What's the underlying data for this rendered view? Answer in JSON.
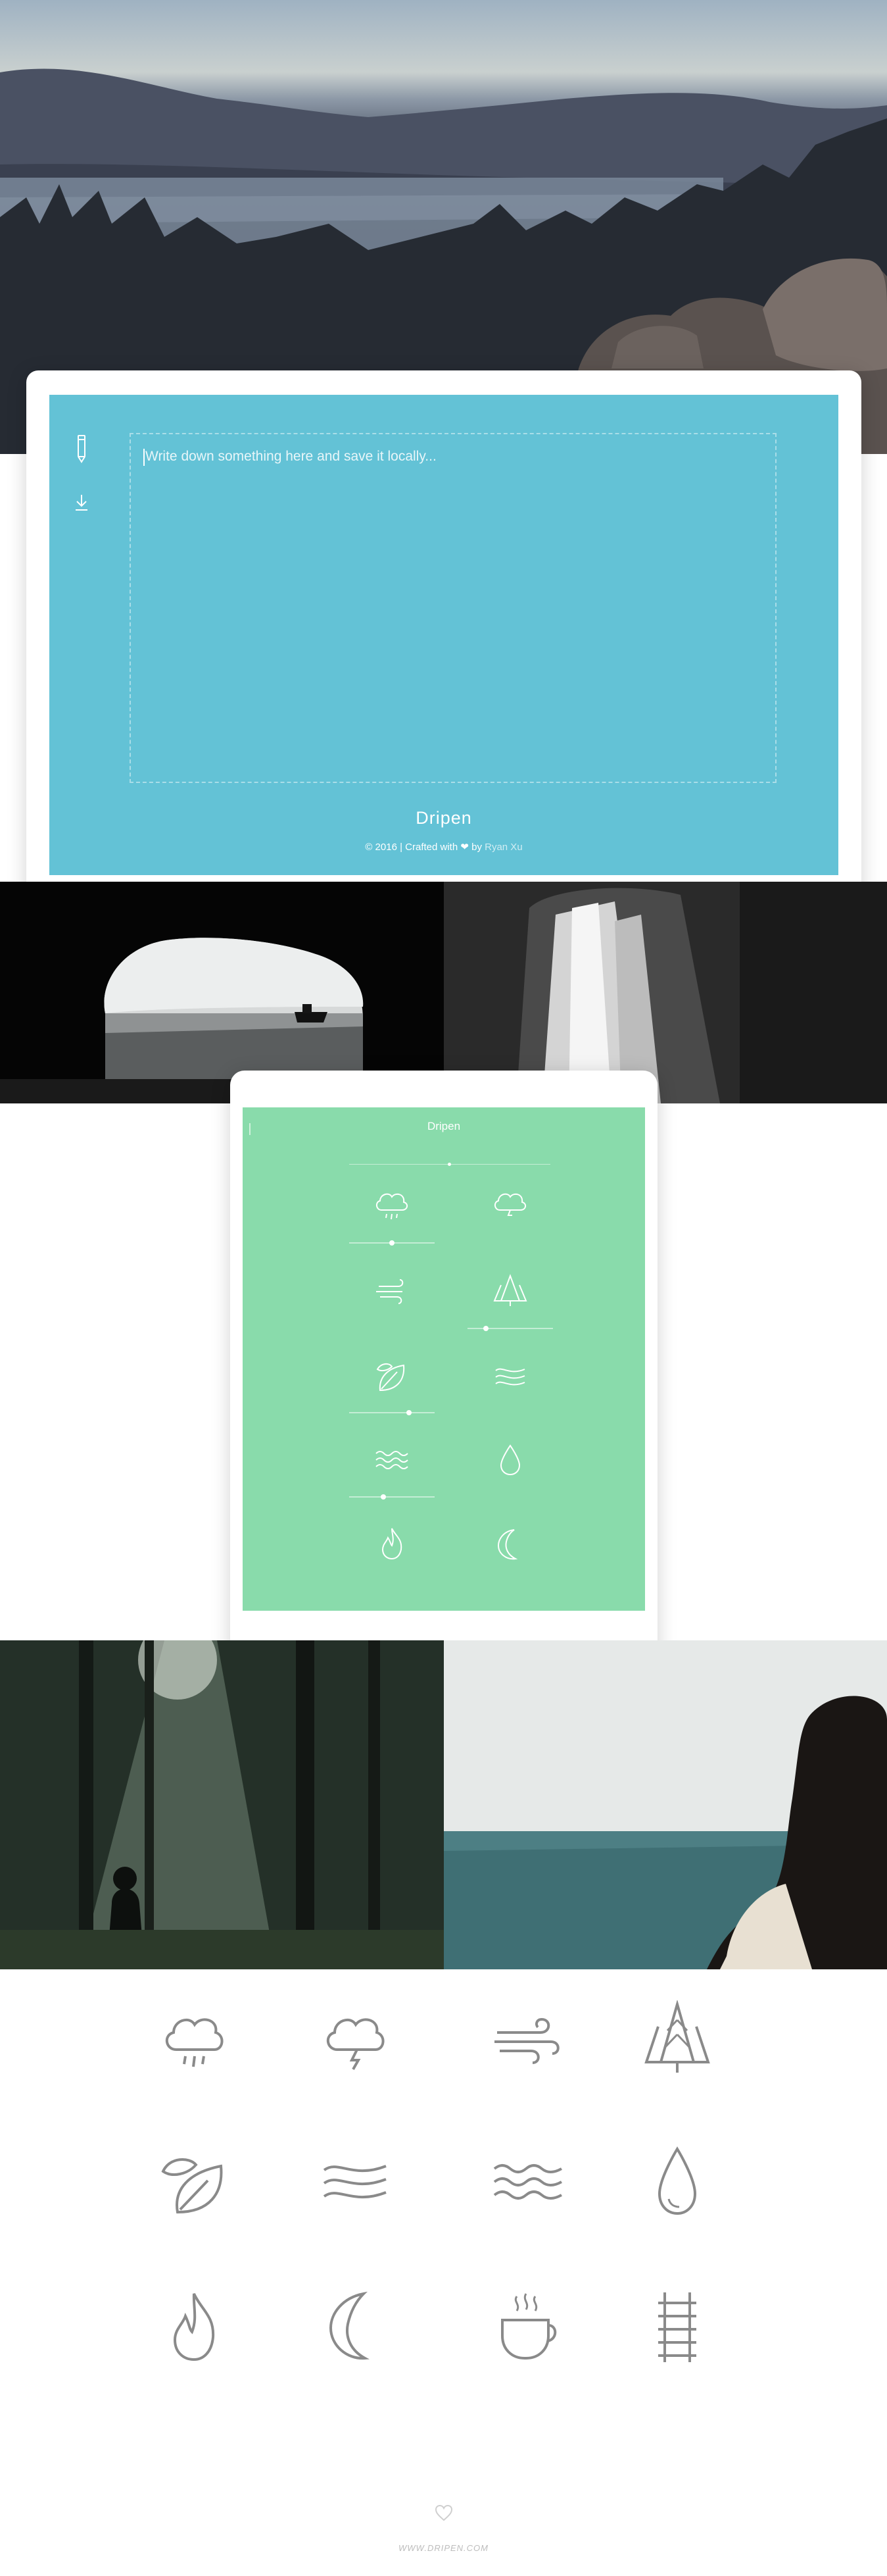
{
  "colors": {
    "desktop_accent": "#63c2d6",
    "tablet_accent": "#89dbab",
    "icon_gray": "#8a8a8a",
    "footer_text": "#bdbdbd"
  },
  "desktop": {
    "placeholder": "Write down something here and save it locally...",
    "brand": "Dripen",
    "credits_prefix": "© 2016 | Crafted with",
    "credits_by": "by",
    "author": "Ryan Xu",
    "side_icons": [
      "pencil-icon",
      "download-icon"
    ]
  },
  "tablet": {
    "title": "Dripen",
    "sounds": [
      {
        "icon": "rain-cloud-icon",
        "level": 0.5
      },
      {
        "icon": "thunder-cloud-icon",
        "level": null
      },
      {
        "icon": "wind-icon",
        "level": null
      },
      {
        "icon": "forest-icon",
        "level": 0.2
      },
      {
        "icon": "leaf-icon",
        "level": 0.7
      },
      {
        "icon": "waves-icon",
        "level": null
      },
      {
        "icon": "water-icon",
        "level": 0.4
      },
      {
        "icon": "drop-icon",
        "level": null
      },
      {
        "icon": "fire-icon",
        "level": null
      },
      {
        "icon": "moon-icon",
        "level": null
      }
    ]
  },
  "icons_showcase": [
    "rain-cloud-icon",
    "thunder-cloud-icon",
    "wind-icon",
    "forest-icon",
    "leaf-icon",
    "waves-icon",
    "water-icon",
    "drop-icon",
    "fire-icon",
    "moon-icon",
    "coffee-icon",
    "railroad-icon"
  ],
  "footer": {
    "url": "WWW.DRIPEN.COM"
  }
}
